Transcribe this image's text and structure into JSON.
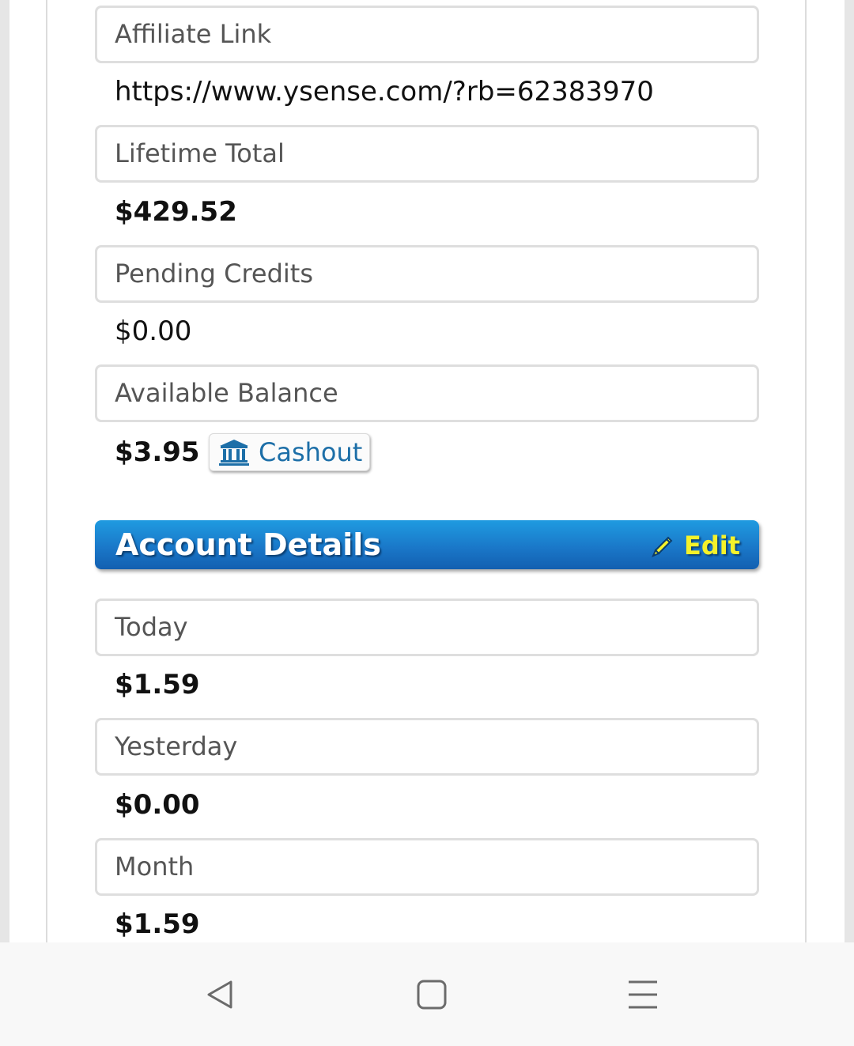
{
  "fields": {
    "affiliate_link": {
      "label": "Affiliate Link",
      "value": "https://www.ysense.com/?rb=62383970"
    },
    "lifetime_total": {
      "label": "Lifetime Total",
      "value": "$429.52"
    },
    "pending_credits": {
      "label": "Pending Credits",
      "value": "$0.00"
    },
    "available_balance": {
      "label": "Available Balance",
      "value": "$3.95"
    }
  },
  "cashout": {
    "label": "Cashout",
    "icon": "bank-icon"
  },
  "account_details": {
    "title": "Account Details",
    "edit_label": "Edit",
    "edit_icon": "pencil-icon",
    "colors": {
      "header": "#1a78c9",
      "edit_text": "#f5f22a"
    },
    "rows": {
      "today": {
        "label": "Today",
        "value": "$1.59"
      },
      "yesterday": {
        "label": "Yesterday",
        "value": "$0.00"
      },
      "month": {
        "label": "Month",
        "value": "$1.59"
      }
    }
  },
  "nav": {
    "back_icon": "back-triangle-icon",
    "home_icon": "home-square-icon",
    "menu_icon": "menu-lines-icon"
  }
}
